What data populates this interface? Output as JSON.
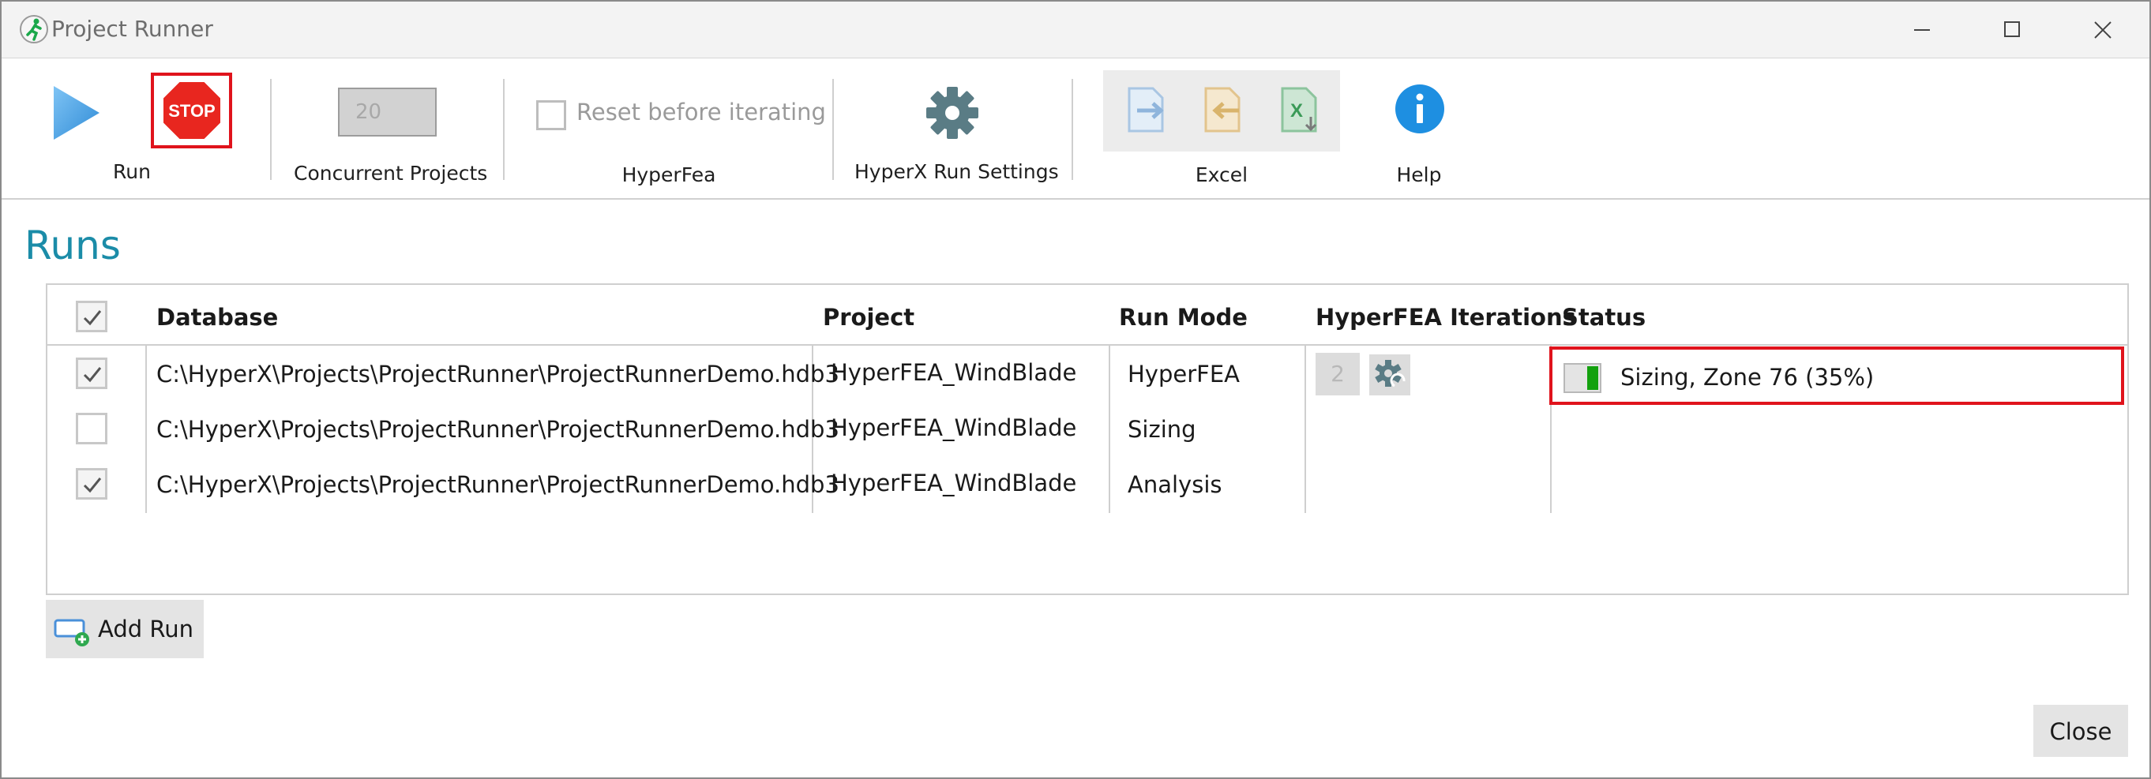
{
  "window": {
    "title": "Project Runner"
  },
  "toolbar": {
    "run_label": "Run",
    "stop_text": "STOP",
    "concurrent_label": "Concurrent Projects",
    "concurrent_value": "20",
    "reset_label": "Reset before iterating",
    "hyperfea_label": "HyperFea",
    "settings_label": "HyperX Run Settings",
    "excel_label": "Excel",
    "help_label": "Help"
  },
  "runs": {
    "title": "Runs",
    "columns": [
      "Database",
      "Project",
      "Run Mode",
      "HyperFEA Iterations",
      "Status"
    ],
    "rows": [
      {
        "checked": true,
        "database": "C:\\HyperX\\Projects\\ProjectRunner\\ProjectRunnerDemo.hdb3",
        "project": "HyperFEA_WindBlade",
        "run_mode": "HyperFEA",
        "iterations": "2",
        "status": "Sizing, Zone 76 (35%)"
      },
      {
        "checked": false,
        "database": "C:\\HyperX\\Projects\\ProjectRunner\\ProjectRunnerDemo.hdb3",
        "project": "HyperFEA_WindBlade",
        "run_mode": "Sizing",
        "iterations": "",
        "status": ""
      },
      {
        "checked": true,
        "database": "C:\\HyperX\\Projects\\ProjectRunner\\ProjectRunnerDemo.hdb3",
        "project": "HyperFEA_WindBlade",
        "run_mode": "Analysis",
        "iterations": "",
        "status": ""
      }
    ],
    "progress_fraction": 0.35
  },
  "buttons": {
    "add_run": "Add Run",
    "close": "Close"
  },
  "colors": {
    "accent": "#1b8ca8",
    "highlight": "#e0131c",
    "progress": "#13a10e",
    "help": "#1e8fe1"
  }
}
